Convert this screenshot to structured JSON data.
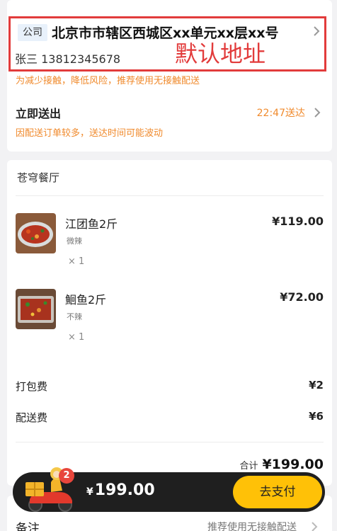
{
  "address": {
    "tag": "公司",
    "title": "北京市市辖区西城区xx单元xx层xx号",
    "contact": "张三 13812345678",
    "default_label": "默认地址"
  },
  "delivery": {
    "notice": "为减少接触，降低风险，推荐使用无接触配送",
    "title": "立即送出",
    "time": "22:47送达",
    "note": "因配送订单较多，送达时间可能波动"
  },
  "order": {
    "shop_name": "苍穹餐厅",
    "items": [
      {
        "name": "江团鱼2斤",
        "spec": "微辣",
        "qty": "× 1",
        "price": "¥119.00",
        "thumb": "fish-dish-thumbnail"
      },
      {
        "name": "鮰鱼2斤",
        "spec": "不辣",
        "qty": "× 1",
        "price": "¥72.00",
        "thumb": "fish-dish-thumbnail"
      }
    ],
    "fees": [
      {
        "label": "打包费",
        "value": "¥2"
      },
      {
        "label": "配送费",
        "value": "¥6"
      }
    ],
    "total_label": "合计",
    "total_value": "¥199.00"
  },
  "note": {
    "title": "备注",
    "hint": "推荐使用无接触配送"
  },
  "paybar": {
    "badge_count": "2",
    "currency": "¥",
    "amount": "199.00",
    "button_label": "去支付"
  },
  "colors": {
    "accent_orange": "#f08a2c",
    "highlight_red": "#e23b3b",
    "pay_button": "#ffc107",
    "pay_bar": "#1f1f1f"
  }
}
